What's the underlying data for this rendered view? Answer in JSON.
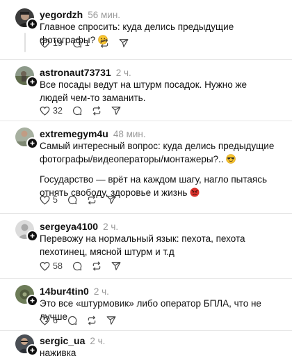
{
  "colors": {
    "text": "#101010",
    "muted": "#999999",
    "icon": "#424242",
    "divider": "#e6e6e6",
    "angry_face": "#d9312b",
    "emoji_yellow": "#f7c531"
  },
  "posts": [
    {
      "username": "yegordzh",
      "time": "56 мин.",
      "lines": [
        "Главное спросить: куда делись предыдущие фотографы?"
      ],
      "emoji": "confused-face",
      "likes": "19",
      "replies": "1"
    },
    {
      "username": "astronaut73731",
      "time": "2 ч.",
      "lines": [
        "Все посады ведут на штурм посадок. Нужно же людей чем-то заманить."
      ],
      "likes": "32"
    },
    {
      "username": "extremegym4u",
      "time": "48 мин.",
      "paragraph1": "Самый интересный вопрос: куда делись предыдущие фотографы/видеоператоры/монтажеры?..",
      "emoji1": "sunglasses-face",
      "paragraph2": "Государство — врёт на каждом шагу, нагло пытаясь отнять свободу, здоровье и жизнь",
      "emoji2": "angry-face",
      "likes": "5"
    },
    {
      "username": "sergeya4100",
      "time": "2 ч.",
      "lines": [
        "Перевожу на нормальный язык: пехота, пехота пехотинец, мясной штурм и т.д"
      ],
      "likes": "58"
    },
    {
      "username": "14bur4tin0",
      "time": "2 ч.",
      "lines": [
        "Это все «штурмовик» либо оператор БПЛА, что не лучше"
      ],
      "likes": "6"
    },
    {
      "username": "sergic_ua",
      "time": "2 ч.",
      "lines": [
        "наживка"
      ]
    }
  ],
  "icons": {
    "like": "heart-icon",
    "reply": "comment-icon",
    "repost": "repost-icon",
    "share": "share-icon",
    "follow": "plus-icon"
  }
}
